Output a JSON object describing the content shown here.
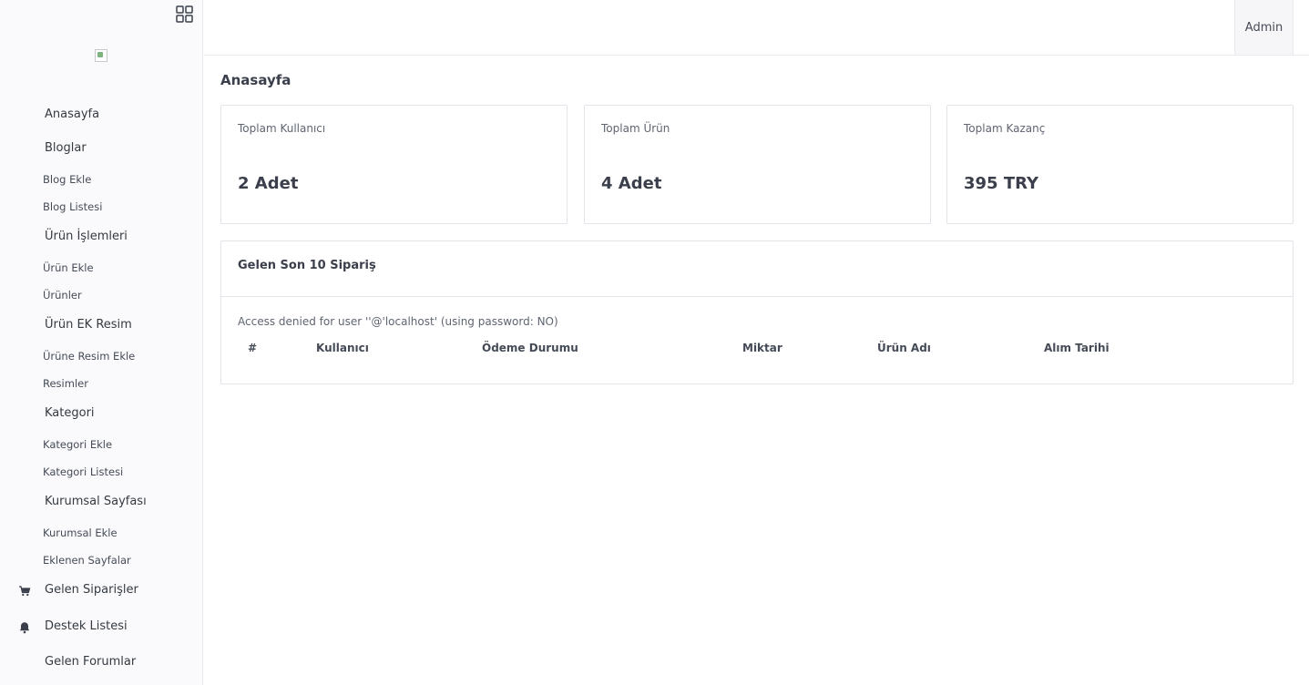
{
  "sidebar": {
    "items": [
      {
        "label": "Anasayfa"
      },
      {
        "label": "Bloglar"
      },
      {
        "label": "Blog Ekle"
      },
      {
        "label": "Blog Listesi"
      },
      {
        "label": "Ürün İşlemleri"
      },
      {
        "label": "Ürün Ekle"
      },
      {
        "label": "Ürünler"
      },
      {
        "label": "Ürün EK Resim"
      },
      {
        "label": "Ürüne Resim Ekle"
      },
      {
        "label": "Resimler"
      },
      {
        "label": "Kategori"
      },
      {
        "label": "Kategori Ekle"
      },
      {
        "label": "Kategori Listesi"
      },
      {
        "label": "Kurumsal Sayfası"
      },
      {
        "label": "Kurumsal Ekle"
      },
      {
        "label": "Eklenen Sayfalar"
      },
      {
        "label": "Gelen Siparişler",
        "icon": "cart-icon"
      },
      {
        "label": "Destek Listesi",
        "icon": "bell-icon"
      },
      {
        "label": "Gelen Forumlar"
      }
    ]
  },
  "header": {
    "user_label": "Admin"
  },
  "main": {
    "title": "Anasayfa",
    "stats": [
      {
        "label": "Toplam Kullanıcı",
        "value": "2 Adet"
      },
      {
        "label": "Toplam Ürün",
        "value": "4 Adet"
      },
      {
        "label": "Toplam Kazanç",
        "value": "395 TRY"
      }
    ],
    "orders": {
      "title": "Gelen Son 10 Sipariş",
      "error": "Access denied for user ''@'localhost' (using password: NO)",
      "columns": [
        "#",
        "Kullanıcı",
        "Ödeme Durumu",
        "Miktar",
        "Ürün Adı",
        "Alım Tarihi"
      ]
    }
  },
  "colors": {
    "sidebar_bg": "#fafafd",
    "text": "#3a3f4b",
    "border": "#e3e4ea"
  }
}
